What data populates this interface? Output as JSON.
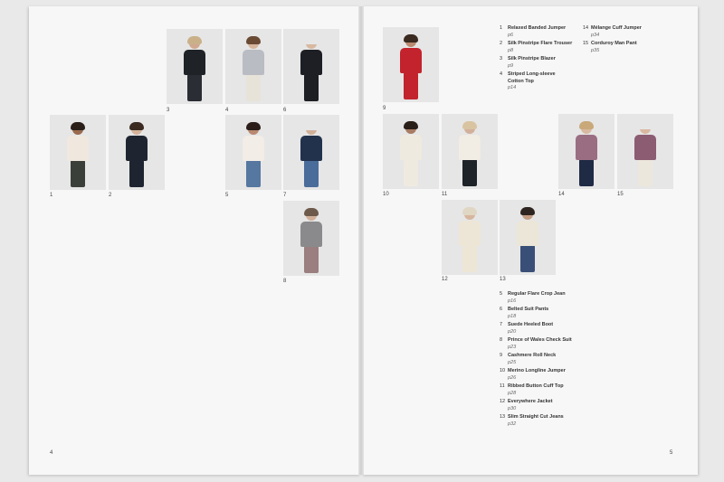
{
  "left_page": {
    "page_number": "4",
    "photos": [
      {
        "id": "p3",
        "caption": "3",
        "top": "#1f2226",
        "bottom": "#2a2d33",
        "skin": "#cfa88e",
        "hair": "#c9b089"
      },
      {
        "id": "p4",
        "caption": "4",
        "top": "#b9bcc2",
        "bottom": "#e8e3d8",
        "skin": "#d6b59c",
        "hair": "#6b4a34"
      },
      {
        "id": "p6",
        "caption": "6",
        "top": "#1d1f24",
        "bottom": "#1d1f24",
        "skin": "#d8b8a0",
        "hair": "#e6e6e6"
      },
      {
        "id": "p1",
        "caption": "1",
        "top": "#f0e8de",
        "bottom": "#3a3f3a",
        "skin": "#9a6a4e",
        "hair": "#2a1e18"
      },
      {
        "id": "p2",
        "caption": "2",
        "top": "#1f2530",
        "bottom": "#1f2530",
        "skin": "#d4b39b",
        "hair": "#3a2a20"
      },
      {
        "id": "p5",
        "caption": "5",
        "top": "#f2ede6",
        "bottom": "#5577a0",
        "skin": "#b98870",
        "hair": "#2b1e18"
      },
      {
        "id": "p7",
        "caption": "7",
        "top": "#22324d",
        "bottom": "#4a6c9a",
        "skin": "#d0b09a",
        "hair": "#e6e6e6"
      },
      {
        "id": "p8",
        "caption": "8",
        "top": "#8a8a8c",
        "bottom": "#9a7e80",
        "skin": "#d1b09a",
        "hair": "#6e5a4a"
      }
    ]
  },
  "right_page": {
    "page_number": "5",
    "photos": [
      {
        "id": "p9",
        "caption": "9",
        "top": "#c2232c",
        "bottom": "#c2232c",
        "skin": "#b98a70",
        "hair": "#3a2a20"
      },
      {
        "id": "p10",
        "caption": "10",
        "top": "#efeae0",
        "bottom": "#efeae0",
        "skin": "#a87c63",
        "hair": "#2a1e18"
      },
      {
        "id": "p11",
        "caption": "11",
        "top": "#f1ece4",
        "bottom": "#1e2229",
        "skin": "#d2b09a",
        "hair": "#d9c4a2"
      },
      {
        "id": "p14",
        "caption": "14",
        "top": "#9a6d82",
        "bottom": "#1f2a44",
        "skin": "#d8b8a0",
        "hair": "#c9a87a"
      },
      {
        "id": "p15",
        "caption": "15",
        "top": "#8c5c72",
        "bottom": "#ece7dc",
        "skin": "#d8b8a0",
        "hair": "#e6e6e6"
      },
      {
        "id": "p12",
        "caption": "12",
        "top": "#ede6d6",
        "bottom": "#ede6d6",
        "skin": "#d6b69e",
        "hair": "#e0d6c4"
      },
      {
        "id": "p13",
        "caption": "13",
        "top": "#ece6d8",
        "bottom": "#3a4f77",
        "skin": "#c49c82",
        "hair": "#2e2520"
      }
    ],
    "index_top_col1": [
      {
        "n": "1",
        "title": "Relaxed Banded Jumper",
        "page": "p6"
      },
      {
        "n": "2",
        "title": "Silk Pinstripe Flare Trouser",
        "page": "p8"
      },
      {
        "n": "3",
        "title": "Silk Pinstripe Blazer",
        "page": "p9"
      },
      {
        "n": "4",
        "title": "Striped Long-sleeve",
        "title2": "Cotton Top",
        "page": "p14"
      }
    ],
    "index_top_col2": [
      {
        "n": "14",
        "title": "Mélange Cuff Jumper",
        "page": "p34"
      },
      {
        "n": "15",
        "title": "Corduroy Man Pant",
        "page": "p35"
      }
    ],
    "index_bottom": [
      {
        "n": "5",
        "title": "Regular Flare Crop Jean",
        "page": "p16"
      },
      {
        "n": "6",
        "title": "Belted Suit Pants",
        "page": "p18"
      },
      {
        "n": "7",
        "title": "Suede Heeled Boot",
        "page": "p20"
      },
      {
        "n": "8",
        "title": "Prince of Wales Check Suit",
        "page": "p23"
      },
      {
        "n": "9",
        "title": "Cashmere Roll Neck",
        "page": "p25"
      },
      {
        "n": "10",
        "title": "Merino Longline Jumper",
        "page": "p26"
      },
      {
        "n": "11",
        "title": "Ribbed Button Cuff Top",
        "page": "p28"
      },
      {
        "n": "12",
        "title": "Everywhere Jacket",
        "page": "p30"
      },
      {
        "n": "13",
        "title": "Slim Straight Cut Jeans",
        "page": "p32"
      }
    ]
  }
}
